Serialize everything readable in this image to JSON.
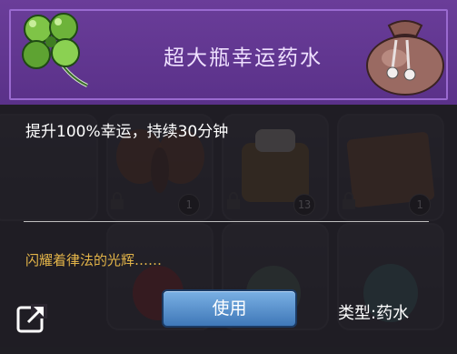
{
  "item": {
    "name": "超大瓶幸运药水",
    "description": "提升100%幸运，持续30分钟",
    "flavor_text": "闪耀着律法的光辉……",
    "type_label": "类型:药水",
    "use_button": "使用",
    "icon": "four-leaf-clover-icon",
    "header_art": "pouch-icon"
  },
  "inventory_bg": {
    "badges": [
      "1",
      "13",
      "1"
    ]
  },
  "colors": {
    "header": "#6a3d99",
    "flavor": "#e2b449",
    "button": "#4f8cc9"
  }
}
